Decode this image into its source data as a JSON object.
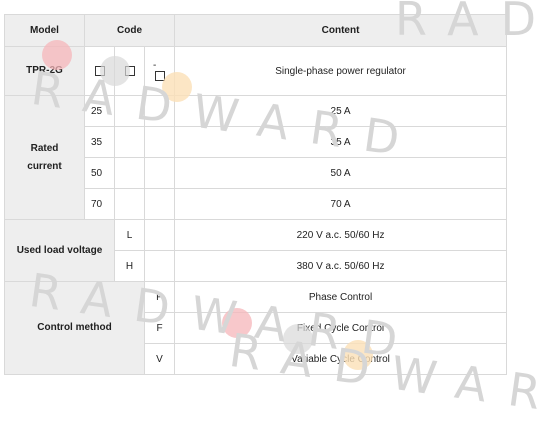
{
  "table": {
    "headers": {
      "model": "Model",
      "code": "Code",
      "content": "Content"
    },
    "model_row": {
      "label": "TPR-2G",
      "code_dash": "-",
      "content": "Single-phase power regulator"
    },
    "rated_current": {
      "label_line1": "Rated",
      "label_line2": "current",
      "rows": [
        {
          "code": "25",
          "content": "25 A"
        },
        {
          "code": "35",
          "content": "35 A"
        },
        {
          "code": "50",
          "content": "50 A"
        },
        {
          "code": "70",
          "content": "70 A"
        }
      ]
    },
    "load_voltage": {
      "label": "Used load voltage",
      "rows": [
        {
          "code": "L",
          "content": "220 V a.c. 50/60 Hz"
        },
        {
          "code": "H",
          "content": "380 V a.c. 50/60 Hz"
        }
      ]
    },
    "control_method": {
      "label": "Control method",
      "rows": [
        {
          "code": "P",
          "content": "Phase Control"
        },
        {
          "code": "F",
          "content": "Fixed Cycle Control"
        },
        {
          "code": "V",
          "content": "Variable Cycle Control"
        }
      ]
    }
  },
  "watermark": "RADWARD",
  "colors": {
    "header_bg": "#eeeeee",
    "border": "#d9d9d9",
    "dot_red": "#f6b6b9",
    "dot_gray": "#d8d8d8",
    "dot_orange": "#fbe0b7"
  }
}
